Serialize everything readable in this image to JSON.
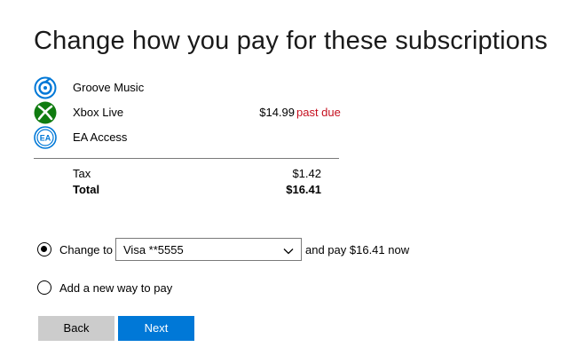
{
  "title": "Change how you pay for these subscriptions",
  "subscriptions": [
    {
      "name": "Groove Music",
      "icon": "groove-music-icon",
      "price": "",
      "status": ""
    },
    {
      "name": "Xbox Live",
      "icon": "xbox-icon",
      "price": "$14.99",
      "status": "past due"
    },
    {
      "name": "EA Access",
      "icon": "ea-access-icon",
      "price": "",
      "status": ""
    }
  ],
  "summary": {
    "tax_label": "Tax",
    "tax_value": "$1.42",
    "total_label": "Total",
    "total_value": "$16.41"
  },
  "payment": {
    "change_label": "Change to",
    "selected_method": "Visa **5555",
    "pay_suffix": "and pay $16.41 now",
    "add_new_label": "Add a new way to pay",
    "change_selected": true
  },
  "buttons": {
    "back": "Back",
    "next": "Next"
  },
  "colors": {
    "accent": "#0078d7",
    "past_due": "#c50f1f",
    "secondary_button": "#cccccc"
  }
}
